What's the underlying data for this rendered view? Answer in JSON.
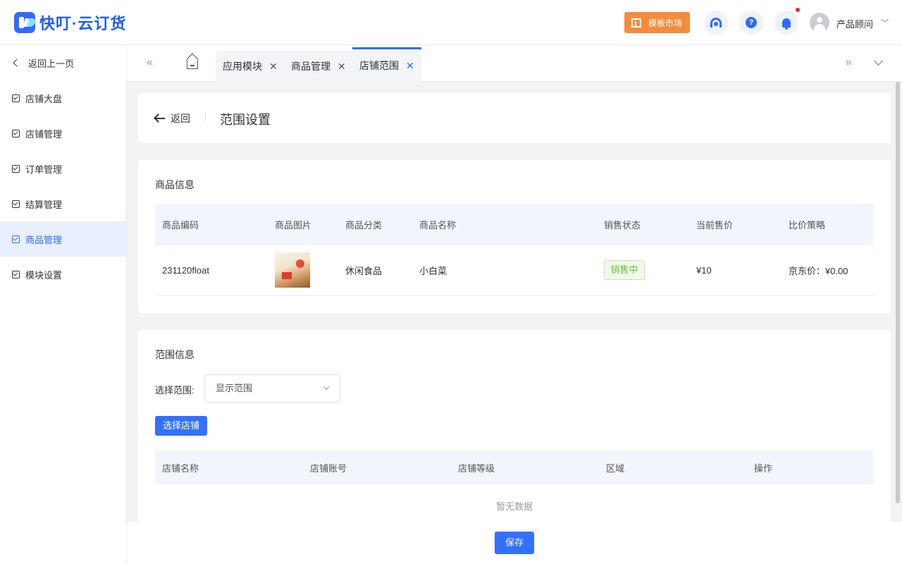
{
  "header": {
    "logo_text": "快叮·云订货",
    "template_market": "模板市场",
    "help_icon_glyph": "?",
    "user_name": "产品顾问"
  },
  "sidebar": {
    "back": "返回上一页",
    "items": [
      {
        "label": "店铺大盘",
        "active": false
      },
      {
        "label": "店铺管理",
        "active": false
      },
      {
        "label": "订单管理",
        "active": false
      },
      {
        "label": "结算管理",
        "active": false
      },
      {
        "label": "商品管理",
        "active": true
      },
      {
        "label": "模块设置",
        "active": false
      }
    ]
  },
  "tabs": [
    {
      "label": "应用模块",
      "active": false
    },
    {
      "label": "商品管理",
      "active": false
    },
    {
      "label": "店铺范围",
      "active": true
    }
  ],
  "page": {
    "back_label": "返回",
    "title": "范围设置"
  },
  "goods_section": {
    "title": "商品信息",
    "columns": [
      "商品编码",
      "商品图片",
      "商品分类",
      "商品名称",
      "销售状态",
      "当前售价",
      "比价策略"
    ],
    "row": {
      "code": "231120float",
      "category": "休闲食品",
      "name": "小白菜",
      "status": "销售中",
      "price": "¥10",
      "strategy": "京东价：¥0.00"
    }
  },
  "scope_section": {
    "title": "范围信息",
    "select_label": "选择范围:",
    "select_value": "显示范围",
    "select_shop_button": "选择店铺",
    "columns": [
      "店铺名称",
      "店铺账号",
      "店铺等级",
      "区域",
      "操作"
    ],
    "empty_text": "暂无数据"
  },
  "footer": {
    "save_button": "保存"
  },
  "colors": {
    "primary": "#3370ff",
    "orange": "#f58c3c",
    "success": "#67c23a"
  }
}
